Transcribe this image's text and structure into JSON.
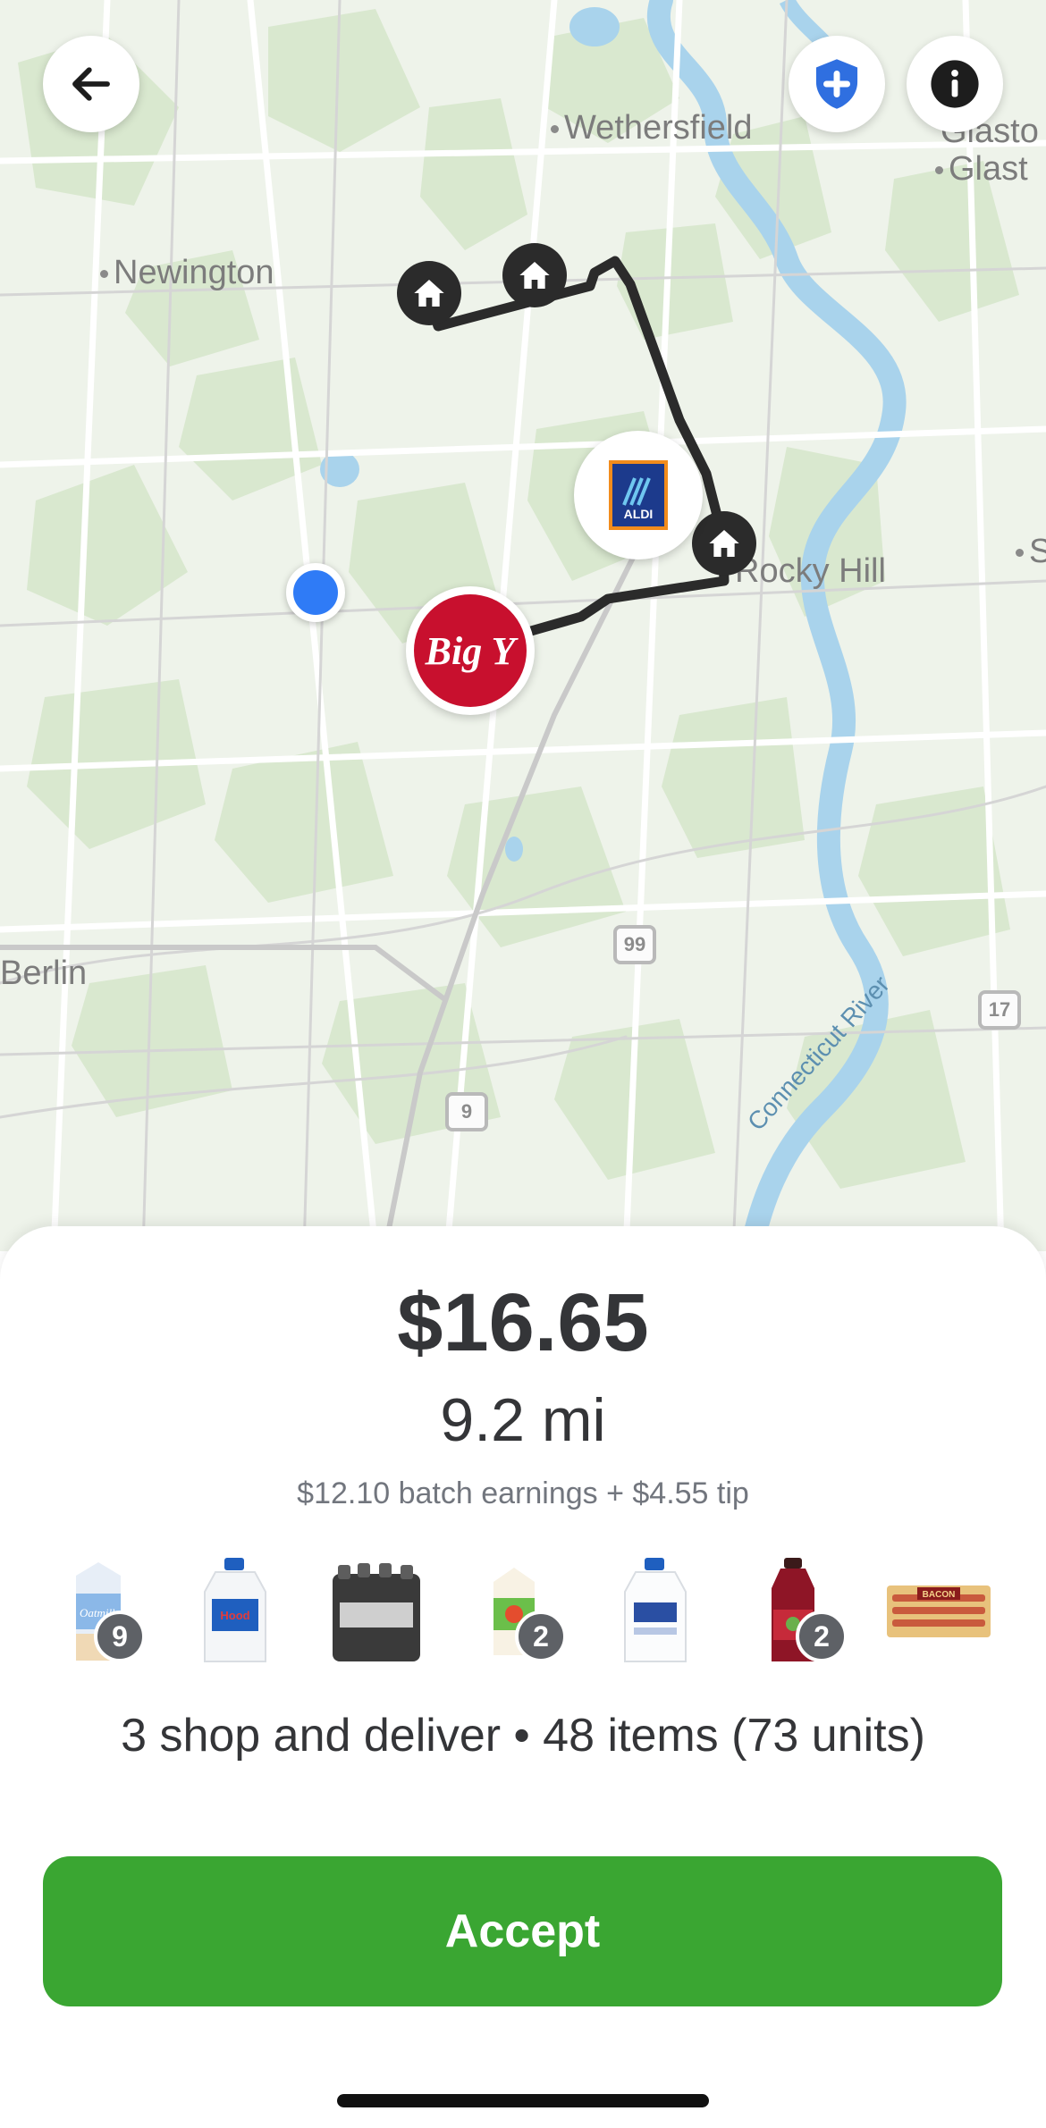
{
  "map": {
    "labels": {
      "wethersfield": "Wethersfield",
      "newington": "Newington",
      "rocky_hill": "Rocky Hill",
      "berlin": "Berlin",
      "glastonbury_1": "Glasto",
      "glastonbury_2": "Glast",
      "right_edge": "S",
      "river": "Connecticut River"
    },
    "route_shields": {
      "r99": "99",
      "r9": "9",
      "r17": "17"
    },
    "stores": {
      "aldi": "ALDI",
      "big_y": "Big Y"
    },
    "icons": {
      "back": "arrow-left-icon",
      "safety": "shield-plus-icon",
      "info": "info-icon",
      "home": "home-icon"
    },
    "colors": {
      "route": "#2b2b2b",
      "user_location": "#2f7bf6",
      "shield_blue": "#2f6fe0"
    }
  },
  "offer": {
    "price": "$16.65",
    "distance": "9.2 mi",
    "breakdown": "$12.10 batch earnings + $4.55 tip",
    "summary": "3 shop and deliver • 48 items (73 units)",
    "accept_label": "Accept",
    "accept_color": "#3aa632"
  },
  "items": [
    {
      "name": "oatmilk-carton",
      "label": "Oatmilk",
      "badge": "9"
    },
    {
      "name": "milk-gallon-hood",
      "label": "Hood",
      "badge": ""
    },
    {
      "name": "water-bottle-pack",
      "label": "",
      "badge": ""
    },
    {
      "name": "juice-carton",
      "label": "",
      "badge": "2"
    },
    {
      "name": "milk-gallon-white",
      "label": "",
      "badge": ""
    },
    {
      "name": "cranberry-juice-bottle",
      "label": "",
      "badge": "2"
    },
    {
      "name": "bacon-pack",
      "label": "BACON",
      "badge": ""
    }
  ]
}
